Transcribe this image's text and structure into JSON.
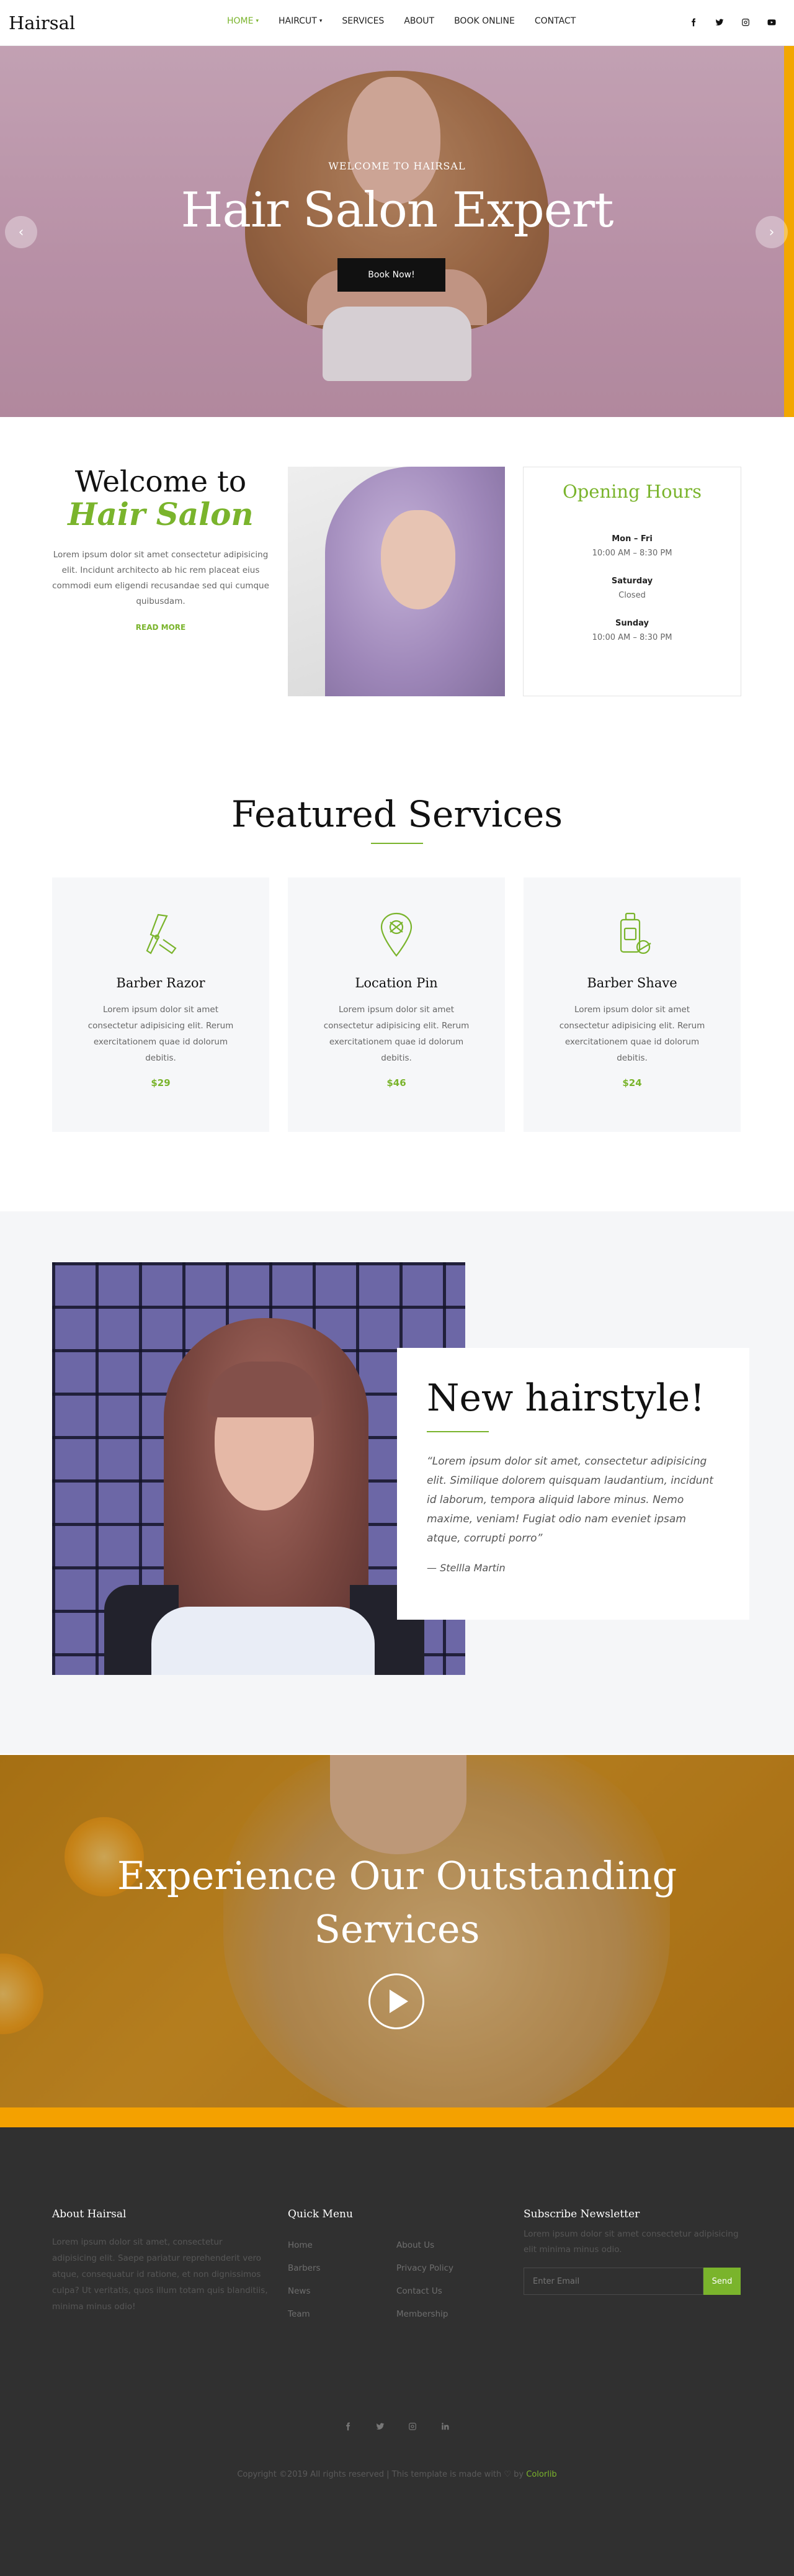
{
  "nav": {
    "logo": "Hairsal",
    "items": [
      {
        "label": "HOME",
        "caret": "▾"
      },
      {
        "label": "HAIRCUT",
        "caret": "▾"
      },
      {
        "label": "SERVICES"
      },
      {
        "label": "ABOUT"
      },
      {
        "label": "BOOK ONLINE"
      },
      {
        "label": "CONTACT"
      }
    ],
    "active_color": "#7ab42c",
    "social": [
      "facebook-icon",
      "twitter-icon",
      "instagram-icon",
      "youtube-icon"
    ]
  },
  "hero": {
    "subtitle": "WELCOME TO HAIRSAL",
    "title": "Hair Salon Expert",
    "button": "Book Now!",
    "prev": "‹",
    "next": "›"
  },
  "welcome": {
    "title": "Welcome to",
    "title_accent": "Hair Salon",
    "text": "Lorem ipsum dolor sit amet consectetur adipisicing elit. Incidunt architecto ab hic rem placeat eius commodi eum eligendi recusandae sed qui cumque quibusdam.",
    "link": "READ MORE"
  },
  "hours": {
    "title": "Opening Hours",
    "rows": [
      {
        "day": "Mon – Fri",
        "time": "10:00 AM – 8:30 PM"
      },
      {
        "day": "Saturday",
        "time": "Closed"
      },
      {
        "day": "Sunday",
        "time": "10:00 AM – 8:30 PM"
      }
    ]
  },
  "featured": {
    "title": "Featured Services",
    "cards": [
      {
        "icon": "razor-icon",
        "name": "Barber Razor",
        "text": "Lorem ipsum dolor sit amet consectetur adipisicing elit. Rerum exercitationem quae id dolorum debitis.",
        "price": "$29"
      },
      {
        "icon": "location-pin-icon",
        "name": "Location Pin",
        "text": "Lorem ipsum dolor sit amet consectetur adipisicing elit. Rerum exercitationem quae id dolorum debitis.",
        "price": "$46"
      },
      {
        "icon": "shave-icon",
        "name": "Barber Shave",
        "text": "Lorem ipsum dolor sit amet consectetur adipisicing elit. Rerum exercitationem quae id dolorum debitis.",
        "price": "$24"
      }
    ]
  },
  "hairstyle": {
    "title": "New hairstyle!",
    "quote": "“Lorem ipsum dolor sit amet, consectetur adipisicing elit. Similique dolorem quisquam laudantium, incidunt id laborum, tempora aliquid labore minus. Nemo maxime, veniam! Fugiat odio nam eveniet ipsam atque, corrupti porro”",
    "author": "— Stellla Martin"
  },
  "experience": {
    "title_line1": "Experience Our Outstanding",
    "title_line2": "Services"
  },
  "footer": {
    "about_title": "About Hairsal",
    "about_text": "Lorem ipsum dolor sit amet, consectetur adipisicing elit. Saepe pariatur reprehenderit vero atque, consequatur id ratione, et non dignissimos culpa? Ut veritatis, quos illum totam quis blanditiis, minima minus odio!",
    "quick_title": "Quick Menu",
    "quick_col1": [
      "Home",
      "Barbers",
      "News",
      "Team"
    ],
    "quick_col2": [
      "About Us",
      "Privacy Policy",
      "Contact Us",
      "Membership"
    ],
    "news_title": "Subscribe Newsletter",
    "news_text": "Lorem ipsum dolor sit amet consectetur adipisicing elit minima minus odio.",
    "email_placeholder": "Enter Email",
    "send": "Send",
    "social": [
      "facebook-icon",
      "twitter-icon",
      "instagram-icon",
      "linkedin-icon"
    ],
    "copyright_pre": "Copyright ©2019 All rights reserved | This template is made with ♡ by ",
    "copyright_brand": "Colorlib"
  },
  "colors": {
    "accent": "#7ab42c",
    "footer_bg": "#303030",
    "hero_stripe": "#f2a700"
  }
}
